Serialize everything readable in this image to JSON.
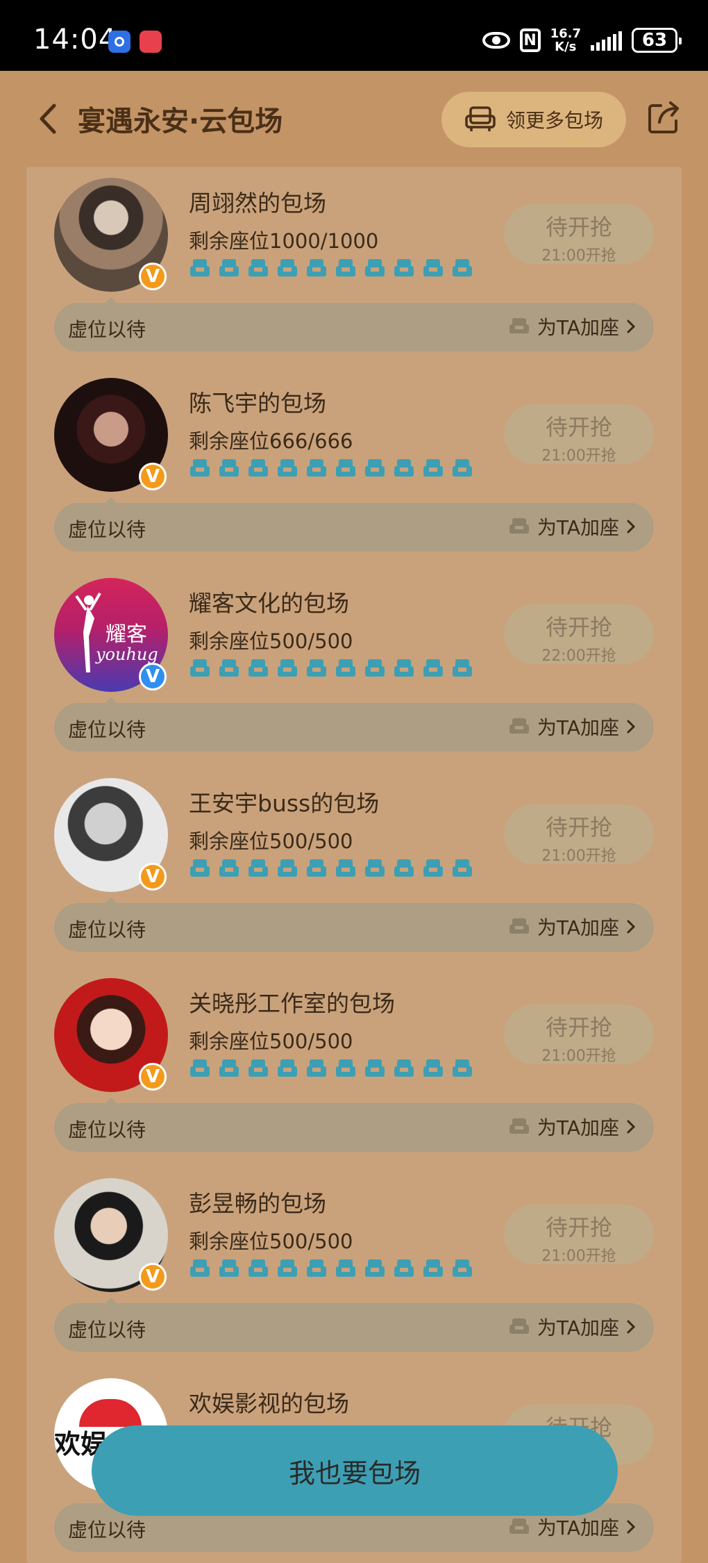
{
  "status_bar": {
    "time": "14:04",
    "speed_value": "16.7",
    "speed_unit": "K/s",
    "battery": "63",
    "nfc": "N"
  },
  "header": {
    "title": "宴遇永安·云包场",
    "more_label": "领更多包场"
  },
  "cards": [
    {
      "title": "周翊然的包场",
      "seats": "剩余座位1000/1000",
      "grab_label": "待开抢",
      "grab_time": "21:00开抢",
      "bar_left": "虚位以待",
      "bar_right": "为TA加座",
      "verified": "orange"
    },
    {
      "title": "陈飞宇的包场",
      "seats": "剩余座位666/666",
      "grab_label": "待开抢",
      "grab_time": "21:00开抢",
      "bar_left": "虚位以待",
      "bar_right": "为TA加座",
      "verified": "orange"
    },
    {
      "title": "耀客文化的包场",
      "seats": "剩余座位500/500",
      "grab_label": "待开抢",
      "grab_time": "22:00开抢",
      "bar_left": "虚位以待",
      "bar_right": "为TA加座",
      "verified": "blue",
      "avatar_text": "耀客",
      "avatar_subtext": "youhug"
    },
    {
      "title": "王安宇buss的包场",
      "seats": "剩余座位500/500",
      "grab_label": "待开抢",
      "grab_time": "21:00开抢",
      "bar_left": "虚位以待",
      "bar_right": "为TA加座",
      "verified": "orange"
    },
    {
      "title": "关晓彤工作室的包场",
      "seats": "剩余座位500/500",
      "grab_label": "待开抢",
      "grab_time": "21:00开抢",
      "bar_left": "虚位以待",
      "bar_right": "为TA加座",
      "verified": "orange"
    },
    {
      "title": "彭昱畅的包场",
      "seats": "剩余座位500/500",
      "grab_label": "待开抢",
      "grab_time": "21:00开抢",
      "bar_left": "虚位以待",
      "bar_right": "为TA加座",
      "verified": "orange"
    },
    {
      "title": "欢娱影视的包场",
      "seats": "",
      "grab_label": "待开抢",
      "grab_time": "",
      "bar_left": "虚位以待",
      "bar_right": "为TA加座",
      "verified": "none",
      "avatar_text": "欢娱"
    }
  ],
  "verified_badge_text": "V",
  "bottom_button": "我也要包场",
  "colors": {
    "page_bg": "#c39465",
    "seat_icon": "#3d9fb3",
    "bottom_button": "#3d9fb3",
    "verified_orange": "#f49a1a",
    "verified_blue": "#2f8ff0"
  }
}
